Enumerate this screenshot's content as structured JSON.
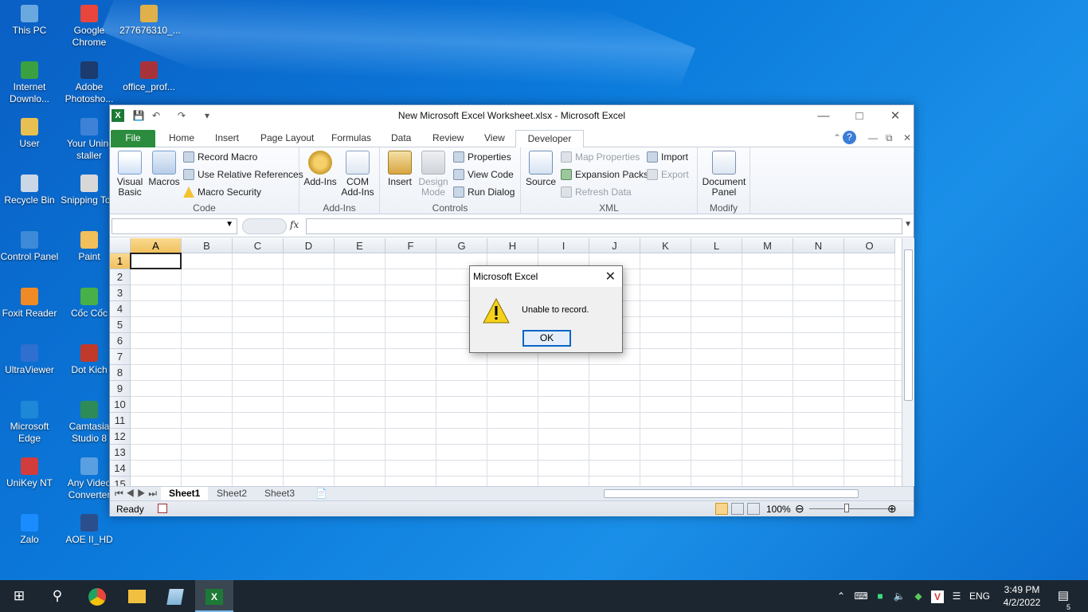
{
  "desktop": {
    "icons": [
      {
        "label": "This PC",
        "icon": "computer-icon",
        "color": "#6aa8e0"
      },
      {
        "label": "Google Chrome",
        "icon": "chrome-icon",
        "color": "#e8453c"
      },
      {
        "label": "277676310_...",
        "icon": "image-file-icon",
        "color": "#e0b04a"
      },
      {
        "label": "Internet Downlo...",
        "icon": "idm-icon",
        "color": "#3aa040"
      },
      {
        "label": "Adobe Photosho...",
        "icon": "photoshop-icon",
        "color": "#1c3b6e"
      },
      {
        "label": "office_prof...",
        "icon": "winrar-icon",
        "color": "#a8323a"
      },
      {
        "label": "User",
        "icon": "user-folder-icon",
        "color": "#e8c052"
      },
      {
        "label": "Your Unin-staller",
        "icon": "uninstaller-icon",
        "color": "#3e82d8"
      },
      {
        "label": "Recycle Bin",
        "icon": "recycle-bin-icon",
        "color": "#c9d7e6"
      },
      {
        "label": "Snipping Tool",
        "icon": "snipping-tool-icon",
        "color": "#d8d8d8"
      },
      {
        "label": "Control Panel",
        "icon": "control-panel-icon",
        "color": "#3c8ad8"
      },
      {
        "label": "Paint",
        "icon": "paint-icon",
        "color": "#f2c05a"
      },
      {
        "label": "Foxit Reader",
        "icon": "foxit-icon",
        "color": "#f08a24"
      },
      {
        "label": "Cốc Cốc",
        "icon": "coccoc-icon",
        "color": "#48b048"
      },
      {
        "label": "UltraViewer",
        "icon": "ultraviewer-icon",
        "color": "#2f6fd0"
      },
      {
        "label": "Dot Kich",
        "icon": "dotkich-icon",
        "color": "#c0392b"
      },
      {
        "label": "Microsoft Edge",
        "icon": "edge-icon",
        "color": "#1e88d8"
      },
      {
        "label": "Camtasia Studio 8",
        "icon": "camtasia-icon",
        "color": "#2e8b57"
      },
      {
        "label": "UniKey NT",
        "icon": "unikey-icon",
        "color": "#d23c3c"
      },
      {
        "label": "Any Video Converter",
        "icon": "video-converter-icon",
        "color": "#5aa0e0"
      },
      {
        "label": "Zalo",
        "icon": "zalo-icon",
        "color": "#1a8cff"
      },
      {
        "label": "AOE II_HD",
        "icon": "aoe-icon",
        "color": "#2b4f8c"
      }
    ]
  },
  "excel": {
    "title": "New Microsoft Excel Worksheet.xlsx  -  Microsoft Excel",
    "tabs": [
      "File",
      "Home",
      "Insert",
      "Page Layout",
      "Formulas",
      "Data",
      "Review",
      "View",
      "Developer"
    ],
    "ribbon": {
      "code": {
        "label": "Code",
        "visual_basic": "Visual Basic",
        "macros": "Macros",
        "record_macro": "Record Macro",
        "relative_refs": "Use Relative References",
        "macro_security": "Macro Security"
      },
      "addins": {
        "label": "Add-Ins",
        "addins": "Add-Ins",
        "com_addins": "COM Add-Ins"
      },
      "controls": {
        "label": "Controls",
        "insert": "Insert",
        "design_mode": "Design Mode",
        "properties": "Properties",
        "view_code": "View Code",
        "run_dialog": "Run Dialog"
      },
      "xml": {
        "label": "XML",
        "source": "Source",
        "map_properties": "Map Properties",
        "expansion_packs": "Expansion Packs",
        "refresh_data": "Refresh Data",
        "import": "Import",
        "export": "Export"
      },
      "modify": {
        "label": "Modify",
        "document_panel": "Document Panel"
      }
    },
    "formula_bar": {
      "fx": "fx",
      "name_value": "",
      "formula_value": ""
    },
    "columns": [
      "A",
      "B",
      "C",
      "D",
      "E",
      "F",
      "G",
      "H",
      "I",
      "J",
      "K",
      "L",
      "M",
      "N",
      "O"
    ],
    "rows": [
      "1",
      "2",
      "3",
      "4",
      "5",
      "6",
      "7",
      "8",
      "9",
      "10",
      "11",
      "12",
      "13",
      "14",
      "15"
    ],
    "sheets": [
      "Sheet1",
      "Sheet2",
      "Sheet3"
    ],
    "status": {
      "ready": "Ready",
      "zoom": "100%"
    }
  },
  "dialog": {
    "title": "Microsoft Excel",
    "message": "Unable to record.",
    "ok": "OK"
  },
  "taskbar": {
    "language": "ENG",
    "time": "3:49 PM",
    "date": "4/2/2022",
    "notifications": "5"
  },
  "colors": {
    "excel_green": "#2a8c3c",
    "taskbar": "#1c2630",
    "desktop": "#0a78d4"
  }
}
